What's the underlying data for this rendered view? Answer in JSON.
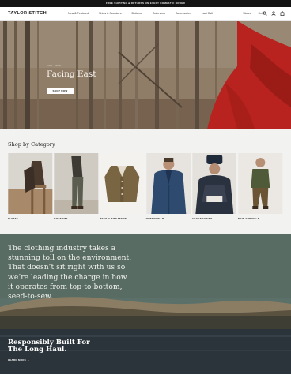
{
  "announcement": "FREE SHIPPING & RETURNS ON EVERY DOMESTIC ORDER",
  "brand": "TAYLOR STITCH",
  "nav": {
    "links": [
      "New & Featured",
      "Shirts & Sweaters",
      "Bottoms",
      "Outerwear",
      "Accessories",
      "Last Call"
    ],
    "right_links": [
      "Stores",
      "Help"
    ],
    "icons": [
      "search-icon",
      "user-icon",
      "bag-icon"
    ]
  },
  "hero": {
    "kicker": "FALL 2023",
    "title": "Facing East",
    "button": "SHOP NOW"
  },
  "categories": {
    "title": "Shop by Category",
    "items": [
      {
        "label": "SHIRTS"
      },
      {
        "label": "BOTTOMS"
      },
      {
        "label": "TEES & SWEATERS"
      },
      {
        "label": "OUTERWEAR"
      },
      {
        "label": "ACCESSORIES"
      },
      {
        "label": "NEW ARRIVALS"
      }
    ]
  },
  "environment": {
    "statement": "The clothing industry takes a stunning toll on the environment. That doesn’t sit right with us so we’re leading the charge in how it operates from top-to-bottom, seed-to-sew.",
    "heading": "Responsibly Built For The Long Haul.",
    "link": "LEARN MORE"
  },
  "colors": {
    "announcement_bg": "#141414",
    "hero_accent_red": "#b8231f",
    "section_bg": "#f2f2f0"
  }
}
